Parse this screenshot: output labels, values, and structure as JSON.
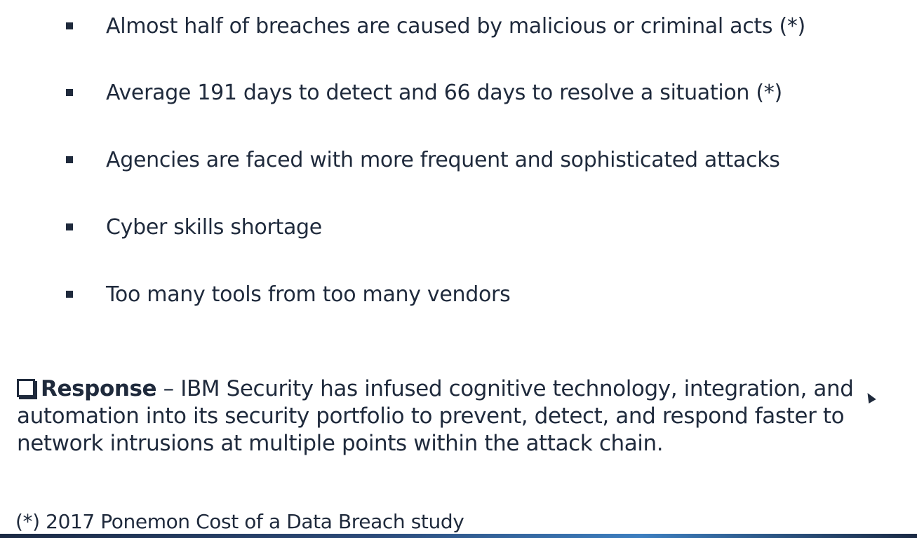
{
  "bullets": [
    "Almost half of breaches are caused by malicious or criminal acts (*)",
    "Average 191 days to detect and 66 days to resolve a situation (*)",
    "Agencies are faced with more frequent and sophisticated attacks",
    "Cyber skills shortage",
    "Too many tools from too many vendors"
  ],
  "response": {
    "label": "Response",
    "text": " – IBM Security has infused cognitive technology, integration, and automation into its security portfolio to prevent, detect, and respond faster to network intrusions at multiple points within the attack chain."
  },
  "footnote": "(*) 2017 Ponemon Cost of a Data Breach study",
  "icons": {
    "bullet": "square-bullet-icon",
    "response": "checkbox-icon",
    "cursor": "mouse-cursor-icon"
  },
  "colors": {
    "text": "#1f2a3c",
    "background": "#ffffff"
  }
}
